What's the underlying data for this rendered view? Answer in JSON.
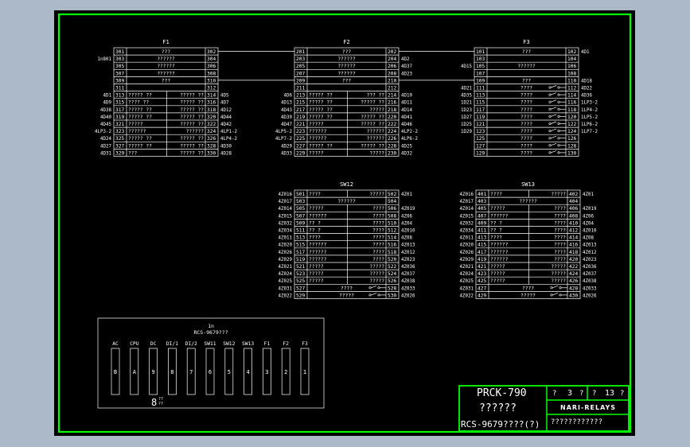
{
  "drawing": {
    "blocks": [
      {
        "title": "F1",
        "rows": [
          {
            "ln": "301",
            "lx": "???",
            "rn": "302",
            "left": "",
            "right": ""
          },
          {
            "ln": "303",
            "lx": "??????",
            "rn": "304",
            "left": "1n801",
            "right": ""
          },
          {
            "ln": "305",
            "lx": "??????",
            "rn": "306",
            "left": "",
            "right": ""
          },
          {
            "ln": "307",
            "lx": "??????",
            "rn": "308",
            "left": "",
            "right": ""
          },
          {
            "ln": "309",
            "lx": "???",
            "rn": "310",
            "left": "",
            "right": ""
          },
          {
            "ln": "311",
            "lx": "",
            "rn": "312",
            "left": "",
            "right": ""
          },
          {
            "ln": "313",
            "lx": "????? ??",
            "mx": "????? ??",
            "rn": "314",
            "left": "4D1",
            "right": "4D5"
          },
          {
            "ln": "315",
            "lx": "???? ??",
            "mx": "????? ??",
            "rn": "316",
            "left": "4D9",
            "right": "4D7"
          },
          {
            "ln": "317",
            "lx": "????? ??",
            "mx": "????? ??",
            "rn": "318",
            "left": "4D38",
            "right": "4D12"
          },
          {
            "ln": "319",
            "lx": "????? ??",
            "mx": "????? ??",
            "rn": "320",
            "left": "4D40",
            "right": "4D44"
          },
          {
            "ln": "321",
            "lx": "?????",
            "mx": "????? ??",
            "rn": "322",
            "left": "4D45",
            "right": "4D42"
          },
          {
            "ln": "323",
            "lx": "??????",
            "mx": "??????",
            "rn": "324",
            "left": "4LP3-2",
            "right": "4LP1-2"
          },
          {
            "ln": "325",
            "lx": "????? ??",
            "mx": "????? ??",
            "rn": "326",
            "left": "4D24",
            "right": "4LP4-2"
          },
          {
            "ln": "327",
            "lx": "????? ??",
            "mx": "????? ??",
            "rn": "328",
            "left": "4D27",
            "right": "4D30"
          },
          {
            "ln": "329",
            "lx": "???",
            "mx": "????? ??",
            "rn": "330",
            "left": "4D31",
            "right": "4D28"
          }
        ]
      },
      {
        "title": "F2",
        "rows": [
          {
            "ln": "201",
            "lx": "???",
            "rn": "202",
            "left": "",
            "right": ""
          },
          {
            "ln": "203",
            "lx": "??????",
            "rn": "204",
            "left": "",
            "right": "4D2"
          },
          {
            "ln": "205",
            "lx": "??????",
            "rn": "206",
            "left": "",
            "right": "4D37"
          },
          {
            "ln": "207",
            "lx": "??????",
            "rn": "208",
            "left": "",
            "right": "4D23"
          },
          {
            "ln": "209",
            "lx": "???",
            "rn": "210",
            "left": "",
            "right": ""
          },
          {
            "ln": "211",
            "lx": "",
            "rn": "212",
            "left": "",
            "right": ""
          },
          {
            "ln": "213",
            "lx": "????? ??",
            "mx": "??? ??",
            "rn": "214",
            "left": "4D6",
            "right": "4D10"
          },
          {
            "ln": "215",
            "lx": "????? ??",
            "mx": "????? ??",
            "rn": "216",
            "left": "4D13",
            "right": "4D11"
          },
          {
            "ln": "217",
            "lx": "????? ??",
            "mx": "?????",
            "rn": "218",
            "left": "4D43",
            "right": "4D14"
          },
          {
            "ln": "219",
            "lx": "????? ??",
            "mx": "????? ??",
            "rn": "220",
            "left": "4D39",
            "right": "4D41"
          },
          {
            "ln": "221",
            "lx": "?????",
            "mx": "????? ??",
            "rn": "222",
            "left": "4D47",
            "right": "4D46"
          },
          {
            "ln": "223",
            "lx": "??????",
            "mx": "??????",
            "rn": "224",
            "left": "4LP5-2",
            "right": "4LP2-2"
          },
          {
            "ln": "225",
            "lx": "??????",
            "mx": "??????",
            "rn": "226",
            "left": "4LP7-2",
            "right": "4LP6-2"
          },
          {
            "ln": "227",
            "lx": "????? ??",
            "mx": "????? ??",
            "rn": "228",
            "left": "4D29",
            "right": "4D25"
          },
          {
            "ln": "229",
            "lx": "?????",
            "mx": "?????",
            "rn": "230",
            "left": "4D33",
            "right": "4D32"
          }
        ]
      },
      {
        "title": "F3",
        "rows": [
          {
            "ln": "101",
            "lx": "???",
            "rn": "102",
            "left": "",
            "right": "4D1"
          },
          {
            "ln": "103",
            "lx": "",
            "rn": "104",
            "left": "",
            "right": ""
          },
          {
            "ln": "105",
            "lx": "??????",
            "rn": "106",
            "left": "4D15",
            "right": ""
          },
          {
            "ln": "107",
            "lx": "",
            "rn": "108",
            "left": "",
            "right": ""
          },
          {
            "ln": "109",
            "lx": "???",
            "rn": "110",
            "left": "",
            "right": "4D18"
          },
          {
            "ln": "111",
            "lx": "????",
            "rn": "112",
            "left": "4D21",
            "right": "4D22"
          },
          {
            "ln": "113",
            "lx": "????",
            "rn": "114",
            "left": "4D35",
            "right": "4D36"
          },
          {
            "ln": "115",
            "lx": "????",
            "rn": "116",
            "left": "1D21",
            "right": "1LP3-2"
          },
          {
            "ln": "117",
            "lx": "????",
            "rn": "118",
            "left": "1D23",
            "right": "1LP4-2"
          },
          {
            "ln": "119",
            "lx": "????",
            "rn": "120",
            "left": "1D27",
            "right": "1LP5-2"
          },
          {
            "ln": "121",
            "lx": "????",
            "rn": "122",
            "left": "1D25",
            "right": "1LP6-2"
          },
          {
            "ln": "123",
            "lx": "????",
            "rn": "124",
            "left": "1D29",
            "right": "1LP7-2"
          },
          {
            "ln": "125",
            "lx": "????",
            "rn": "126",
            "left": "",
            "right": ""
          },
          {
            "ln": "127",
            "lx": "????",
            "rn": "128",
            "left": "",
            "right": ""
          },
          {
            "ln": "129",
            "lx": "????",
            "rn": "130",
            "left": "",
            "right": ""
          }
        ]
      },
      {
        "title": "SW12",
        "rows": [
          {
            "ln": "501",
            "lx": "????",
            "mx": "?????",
            "rn": "502",
            "left": "4Z016",
            "right": "4Z01"
          },
          {
            "ln": "503",
            "lx": "??????",
            "rn": "504",
            "left": "4Z017",
            "right": ""
          },
          {
            "ln": "505",
            "lx": "?????",
            "mx": "????",
            "rn": "506",
            "left": "4Z014",
            "right": "4Z019"
          },
          {
            "ln": "507",
            "lx": "??????",
            "mx": "????",
            "rn": "508",
            "left": "4Z015",
            "right": "4Z06"
          },
          {
            "ln": "509",
            "lx": "??  ?",
            "mx": "????",
            "rn": "510",
            "left": "4Z032",
            "right": "4Z04"
          },
          {
            "ln": "511",
            "lx": "??  ?",
            "mx": "????",
            "rn": "512",
            "left": "4Z034",
            "right": "4Z010"
          },
          {
            "ln": "513",
            "lx": "????",
            "mx": "????",
            "rn": "514",
            "left": "4Z011",
            "right": "4Z08"
          },
          {
            "ln": "515",
            "lx": "??????",
            "mx": "????",
            "rn": "516",
            "left": "4Z020",
            "right": "4Z013"
          },
          {
            "ln": "517",
            "lx": "??????",
            "mx": "????",
            "rn": "518",
            "left": "4Z026",
            "right": "4Z012"
          },
          {
            "ln": "519",
            "lx": "??????",
            "mx": "????",
            "rn": "520",
            "left": "4Z029",
            "right": "4Z023"
          },
          {
            "ln": "521",
            "lx": "?????",
            "mx": "?????",
            "rn": "522",
            "left": "4Z021",
            "right": "4Z036"
          },
          {
            "ln": "523",
            "lx": "?????",
            "mx": "?????",
            "rn": "524",
            "left": "4Z024",
            "right": "4Z037"
          },
          {
            "ln": "525",
            "lx": "?????",
            "mx": "?????",
            "rn": "526",
            "left": "4Z025",
            "right": "4Z038"
          },
          {
            "ln": "527",
            "lx": "????",
            "mx": "",
            "rn": "528",
            "left": "4Z031",
            "right": "4Z033"
          },
          {
            "ln": "529",
            "lx": "?????",
            "mx": "",
            "rn": "530",
            "left": "4Z022",
            "right": "4Z026"
          }
        ]
      },
      {
        "title": "SW13",
        "rows": [
          {
            "ln": "401",
            "lx": "????",
            "mx": "?????",
            "rn": "402",
            "left": "4Z016",
            "right": "4Z01"
          },
          {
            "ln": "403",
            "lx": "??????",
            "rn": "404",
            "left": "4Z017",
            "right": ""
          },
          {
            "ln": "405",
            "lx": "?????",
            "mx": "????",
            "rn": "406",
            "left": "4Z014",
            "right": "4Z019"
          },
          {
            "ln": "407",
            "lx": "??????",
            "mx": "????",
            "rn": "408",
            "left": "4Z015",
            "right": "4Z06"
          },
          {
            "ln": "409",
            "lx": "??  ?",
            "mx": "????",
            "rn": "410",
            "left": "4Z032",
            "right": "4Z04"
          },
          {
            "ln": "411",
            "lx": "??  ?",
            "mx": "????",
            "rn": "412",
            "left": "4Z034",
            "right": "4Z010"
          },
          {
            "ln": "413",
            "lx": "????",
            "mx": "????",
            "rn": "414",
            "left": "4Z011",
            "right": "4Z08"
          },
          {
            "ln": "415",
            "lx": "??????",
            "mx": "????",
            "rn": "416",
            "left": "4Z020",
            "right": "4Z013"
          },
          {
            "ln": "417",
            "lx": "??????",
            "mx": "????",
            "rn": "418",
            "left": "4Z026",
            "right": "4Z012"
          },
          {
            "ln": "419",
            "lx": "??????",
            "mx": "????",
            "rn": "420",
            "left": "4Z029",
            "right": "4Z023"
          },
          {
            "ln": "421",
            "lx": "?????",
            "mx": "?????",
            "rn": "422",
            "left": "4Z021",
            "right": "4Z036"
          },
          {
            "ln": "423",
            "lx": "?????",
            "mx": "?????",
            "rn": "424",
            "left": "4Z024",
            "right": "4Z037"
          },
          {
            "ln": "425",
            "lx": "?????",
            "mx": "?????",
            "rn": "426",
            "left": "4Z025",
            "right": "4Z038"
          },
          {
            "ln": "427",
            "lx": "????",
            "mx": "",
            "rn": "428",
            "left": "4Z031",
            "right": "4Z033"
          },
          {
            "ln": "429",
            "lx": "?????",
            "mx": "",
            "rn": "430",
            "left": "4Z022",
            "right": "4Z026"
          }
        ]
      }
    ],
    "device": {
      "title": "1n",
      "model": "RCS-9679???",
      "slots": [
        {
          "label": "AC",
          "num": "B"
        },
        {
          "label": "CPU",
          "num": "A"
        },
        {
          "label": "DC",
          "num": "9"
        },
        {
          "label": "DI/1",
          "num": "8"
        },
        {
          "label": "DI/2",
          "num": "7"
        },
        {
          "label": "SW11",
          "num": "6"
        },
        {
          "label": "SW12",
          "num": "5"
        },
        {
          "label": "SW13",
          "num": "4"
        },
        {
          "label": "F1",
          "num": "3"
        },
        {
          "label": "F2",
          "num": "2"
        },
        {
          "label": "F3",
          "num": "1"
        }
      ],
      "footnote_big": "8",
      "footnote_small_1": "??",
      "footnote_small_2": "??"
    }
  },
  "title_block": {
    "product": "PRCK-790",
    "name": "??????",
    "model": "RCS-9679????(?)",
    "sheet_label": "?",
    "sheet_value": "3",
    "sheet_unit": "?",
    "total_label": "?",
    "total_value": "13",
    "total_unit": "?",
    "company": "NARI-RELAYS",
    "bottom": "????????????"
  },
  "colors": {
    "background": "#abb9c9",
    "paper": "#000000",
    "border": "#00ff00",
    "ink": "#ffffff"
  }
}
